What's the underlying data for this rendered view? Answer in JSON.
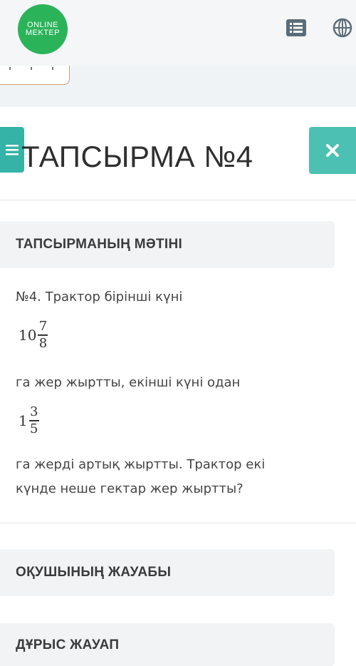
{
  "header": {
    "logo_line1": "ONLINE",
    "logo_line2": "MEKTEP",
    "icons": [
      "list-icon",
      "globe-icon"
    ]
  },
  "page": {
    "title": "ТАПСЫРМА №4"
  },
  "task": {
    "section_title": "ТАПСЫРМАНЫҢ МӘТІНІ",
    "line1": "№4. Трактор бірінші күні",
    "fraction1": {
      "whole": "10",
      "numerator": "7",
      "denominator": "8"
    },
    "line2": " га жер жыртты, екінші күні одан",
    "fraction2": {
      "whole": "1",
      "numerator": "3",
      "denominator": "5"
    },
    "line3": " га жерді артық жыртты. Трактор екі",
    "line4": "күнде неше гектар жер жыртты?"
  },
  "answer": {
    "section_title": "ОҚУШЫНЫҢ ЖАУАБЫ"
  },
  "correct": {
    "section_title": "ДҰРЫС ЖАУАП"
  },
  "colors": {
    "logo_green": "#2bb35a",
    "teal_button": "#4cc0b2",
    "section_bg": "#f1f3f4"
  }
}
